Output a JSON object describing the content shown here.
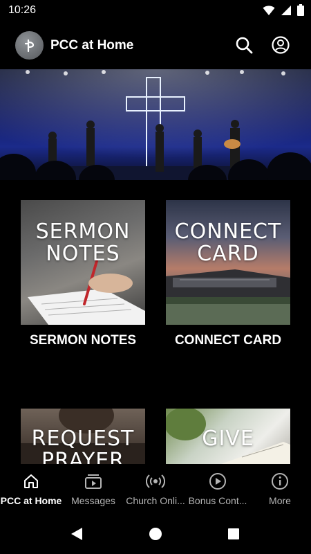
{
  "status_bar": {
    "time": "10:26"
  },
  "app_bar": {
    "title": "PCC at Home"
  },
  "cards": [
    {
      "overlay_line1": "SERMON",
      "overlay_line2": "NOTES",
      "label": "SERMON NOTES"
    },
    {
      "overlay_line1": "CONNECT",
      "overlay_line2": "CARD",
      "label": "CONNECT CARD"
    },
    {
      "overlay_line1": "REQUEST",
      "overlay_line2": "PRAYER",
      "label": ""
    },
    {
      "overlay_line1": "GIVE",
      "overlay_line2": "",
      "label": ""
    }
  ],
  "bottom_nav": {
    "items": [
      {
        "label": "PCC at Home",
        "icon": "home-icon"
      },
      {
        "label": "Messages",
        "icon": "video-library-icon"
      },
      {
        "label": "Church Onli...",
        "icon": "broadcast-icon"
      },
      {
        "label": "Bonus Cont...",
        "icon": "play-circle-icon"
      },
      {
        "label": "More",
        "icon": "info-icon"
      }
    ]
  },
  "colors": {
    "background": "#000000",
    "text": "#ffffff",
    "inactive_nav": "#b5b5b5"
  }
}
